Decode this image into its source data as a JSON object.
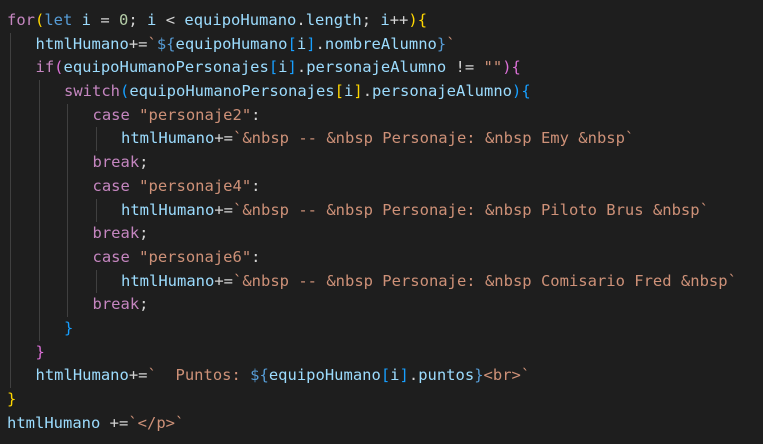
{
  "theme": {
    "background": "#1e1e1e",
    "guide": "#404040",
    "colors": {
      "keyword": "#569cd6",
      "control": "#c586c0",
      "variable": "#9cdcfe",
      "string": "#ce9178",
      "number": "#b5cea8",
      "operator": "#d4d4d4",
      "bracket_level1": "#ffd700",
      "bracket_level2": "#da70d6",
      "bracket_level3": "#179fff"
    }
  },
  "code": {
    "lines": [
      {
        "indent": 0,
        "tokens": [
          {
            "t": "for",
            "c": "t-ctrl"
          },
          {
            "t": "(",
            "c": "t-b1"
          },
          {
            "t": "let",
            "c": "t-kw"
          },
          {
            "t": " i ",
            "c": "t-var"
          },
          {
            "t": "= ",
            "c": "t-op"
          },
          {
            "t": "0",
            "c": "t-num"
          },
          {
            "t": "; ",
            "c": "t-op"
          },
          {
            "t": "i",
            "c": "t-var"
          },
          {
            "t": " < ",
            "c": "t-op"
          },
          {
            "t": "equipoHumano",
            "c": "t-var"
          },
          {
            "t": ".",
            "c": "t-op"
          },
          {
            "t": "length",
            "c": "t-var"
          },
          {
            "t": "; ",
            "c": "t-op"
          },
          {
            "t": "i",
            "c": "t-var"
          },
          {
            "t": "++",
            "c": "t-op"
          },
          {
            "t": ")",
            "c": "t-b1"
          },
          {
            "t": "{",
            "c": "t-b1"
          }
        ]
      },
      {
        "indent": 1,
        "tokens": [
          {
            "t": "htmlHumano",
            "c": "t-var"
          },
          {
            "t": "+=",
            "c": "t-op"
          },
          {
            "t": "`",
            "c": "t-str"
          },
          {
            "t": "${",
            "c": "t-interp"
          },
          {
            "t": "equipoHumano",
            "c": "t-var"
          },
          {
            "t": "[",
            "c": "t-b3"
          },
          {
            "t": "i",
            "c": "t-var"
          },
          {
            "t": "]",
            "c": "t-b3"
          },
          {
            "t": ".",
            "c": "t-op"
          },
          {
            "t": "nombreAlumno",
            "c": "t-var"
          },
          {
            "t": "}",
            "c": "t-interp"
          },
          {
            "t": "`",
            "c": "t-str"
          }
        ]
      },
      {
        "indent": 1,
        "tokens": [
          {
            "t": "if",
            "c": "t-ctrl"
          },
          {
            "t": "(",
            "c": "t-b2"
          },
          {
            "t": "equipoHumanoPersonajes",
            "c": "t-var"
          },
          {
            "t": "[",
            "c": "t-b3"
          },
          {
            "t": "i",
            "c": "t-var"
          },
          {
            "t": "]",
            "c": "t-b3"
          },
          {
            "t": ".",
            "c": "t-op"
          },
          {
            "t": "personajeAlumno",
            "c": "t-var"
          },
          {
            "t": " != ",
            "c": "t-op"
          },
          {
            "t": "\"\"",
            "c": "t-str"
          },
          {
            "t": ")",
            "c": "t-b2"
          },
          {
            "t": "{",
            "c": "t-b2"
          }
        ]
      },
      {
        "indent": 2,
        "tokens": [
          {
            "t": "switch",
            "c": "t-ctrl"
          },
          {
            "t": "(",
            "c": "t-b3"
          },
          {
            "t": "equipoHumanoPersonajes",
            "c": "t-var"
          },
          {
            "t": "[",
            "c": "t-b1"
          },
          {
            "t": "i",
            "c": "t-var"
          },
          {
            "t": "]",
            "c": "t-b1"
          },
          {
            "t": ".",
            "c": "t-op"
          },
          {
            "t": "personajeAlumno",
            "c": "t-var"
          },
          {
            "t": ")",
            "c": "t-b3"
          },
          {
            "t": "{",
            "c": "t-b3"
          }
        ]
      },
      {
        "indent": 3,
        "tokens": [
          {
            "t": "case",
            "c": "t-ctrl"
          },
          {
            "t": " ",
            "c": "t-op"
          },
          {
            "t": "\"personaje2\"",
            "c": "t-str"
          },
          {
            "t": ":",
            "c": "t-op"
          }
        ]
      },
      {
        "indent": 4,
        "tokens": [
          {
            "t": "htmlHumano",
            "c": "t-var"
          },
          {
            "t": "+=",
            "c": "t-op"
          },
          {
            "t": "`&nbsp -- &nbsp Personaje: &nbsp Emy &nbsp`",
            "c": "t-str"
          }
        ]
      },
      {
        "indent": 3,
        "tokens": [
          {
            "t": "break",
            "c": "t-ctrl"
          },
          {
            "t": ";",
            "c": "t-op"
          }
        ]
      },
      {
        "indent": 3,
        "tokens": [
          {
            "t": "case",
            "c": "t-ctrl"
          },
          {
            "t": " ",
            "c": "t-op"
          },
          {
            "t": "\"personaje4\"",
            "c": "t-str"
          },
          {
            "t": ":",
            "c": "t-op"
          }
        ]
      },
      {
        "indent": 4,
        "tokens": [
          {
            "t": "htmlHumano",
            "c": "t-var"
          },
          {
            "t": "+=",
            "c": "t-op"
          },
          {
            "t": "`&nbsp -- &nbsp Personaje: &nbsp Piloto Brus &nbsp`",
            "c": "t-str"
          }
        ]
      },
      {
        "indent": 3,
        "tokens": [
          {
            "t": "break",
            "c": "t-ctrl"
          },
          {
            "t": ";",
            "c": "t-op"
          }
        ]
      },
      {
        "indent": 3,
        "tokens": [
          {
            "t": "case",
            "c": "t-ctrl"
          },
          {
            "t": " ",
            "c": "t-op"
          },
          {
            "t": "\"personaje6\"",
            "c": "t-str"
          },
          {
            "t": ":",
            "c": "t-op"
          }
        ]
      },
      {
        "indent": 4,
        "tokens": [
          {
            "t": "htmlHumano",
            "c": "t-var"
          },
          {
            "t": "+=",
            "c": "t-op"
          },
          {
            "t": "`&nbsp -- &nbsp Personaje: &nbsp Comisario Fred &nbsp`",
            "c": "t-str"
          }
        ]
      },
      {
        "indent": 3,
        "tokens": [
          {
            "t": "break",
            "c": "t-ctrl"
          },
          {
            "t": ";",
            "c": "t-op"
          }
        ]
      },
      {
        "indent": 2,
        "tokens": [
          {
            "t": "}",
            "c": "t-b3"
          }
        ]
      },
      {
        "indent": 1,
        "tokens": [
          {
            "t": "}",
            "c": "t-b2"
          }
        ]
      },
      {
        "indent": 1,
        "tokens": [
          {
            "t": "htmlHumano",
            "c": "t-var"
          },
          {
            "t": "+=",
            "c": "t-op"
          },
          {
            "t": "`  Puntos: ",
            "c": "t-str"
          },
          {
            "t": "${",
            "c": "t-interp"
          },
          {
            "t": "equipoHumano",
            "c": "t-var"
          },
          {
            "t": "[",
            "c": "t-b3"
          },
          {
            "t": "i",
            "c": "t-var"
          },
          {
            "t": "]",
            "c": "t-b3"
          },
          {
            "t": ".",
            "c": "t-op"
          },
          {
            "t": "puntos",
            "c": "t-var"
          },
          {
            "t": "}",
            "c": "t-interp"
          },
          {
            "t": "<br>`",
            "c": "t-str"
          }
        ]
      },
      {
        "indent": 0,
        "tokens": [
          {
            "t": "}",
            "c": "t-b1"
          }
        ]
      },
      {
        "indent": 0,
        "tokens": [
          {
            "t": "htmlHumano",
            "c": "t-var"
          },
          {
            "t": " +=",
            "c": "t-op"
          },
          {
            "t": "`</p>`",
            "c": "t-str"
          }
        ]
      }
    ]
  }
}
